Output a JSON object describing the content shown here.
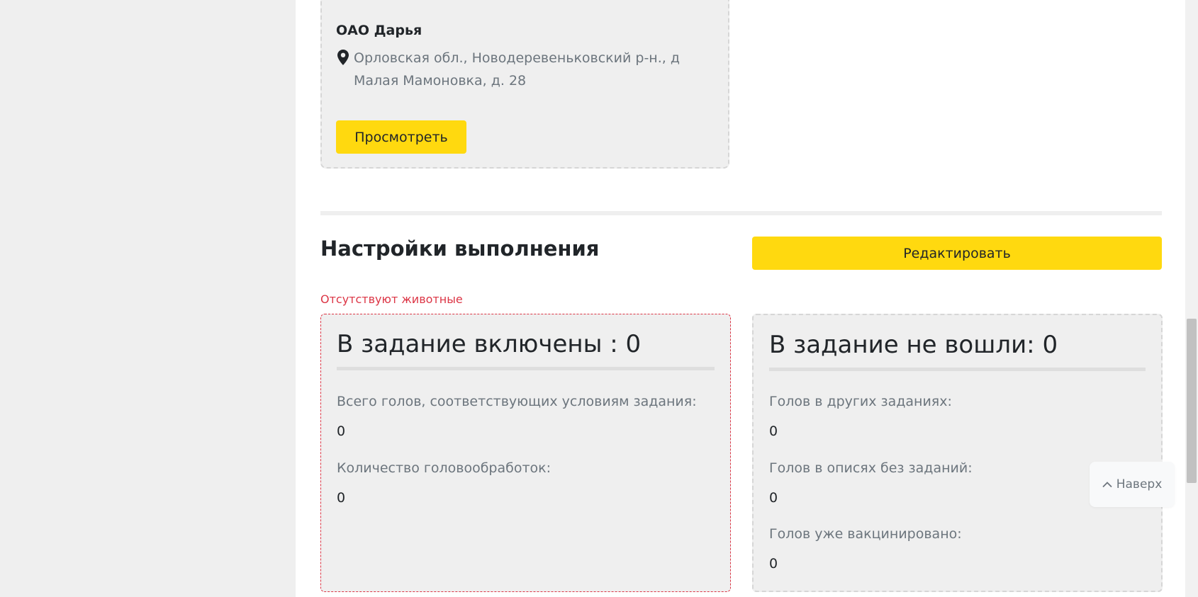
{
  "farm_card": {
    "name": "ОАО Дарья",
    "address": "Орловская обл., Новодеревеньковский р-н., д Малая Мамоновка, д. 28",
    "view_button": "Просмотреть",
    "location_icon": "map-pin-icon"
  },
  "settings": {
    "title": "Настройки выполнения",
    "edit_button": "Редактировать",
    "error": "Отсутствуют животные"
  },
  "included": {
    "title": "В задание включены : 0",
    "stats": [
      {
        "label": "Всего голов, соответствующих условиям задания:",
        "value": "0"
      },
      {
        "label": "Количество головообработок:",
        "value": "0"
      }
    ]
  },
  "excluded": {
    "title": "В задание не вошли: 0",
    "stats": [
      {
        "label": "Голов в других заданиях:",
        "value": "0"
      },
      {
        "label": "Голов в описях без заданий:",
        "value": "0"
      },
      {
        "label": "Голов уже вакцинировано:",
        "value": "0"
      }
    ]
  },
  "back_to_top": {
    "label": "Наверх",
    "icon": "chevron-up-icon"
  },
  "colors": {
    "accent": "#ffd90f",
    "error": "#dc3545",
    "card_bg": "#efefef",
    "muted_text": "#6c757d"
  }
}
